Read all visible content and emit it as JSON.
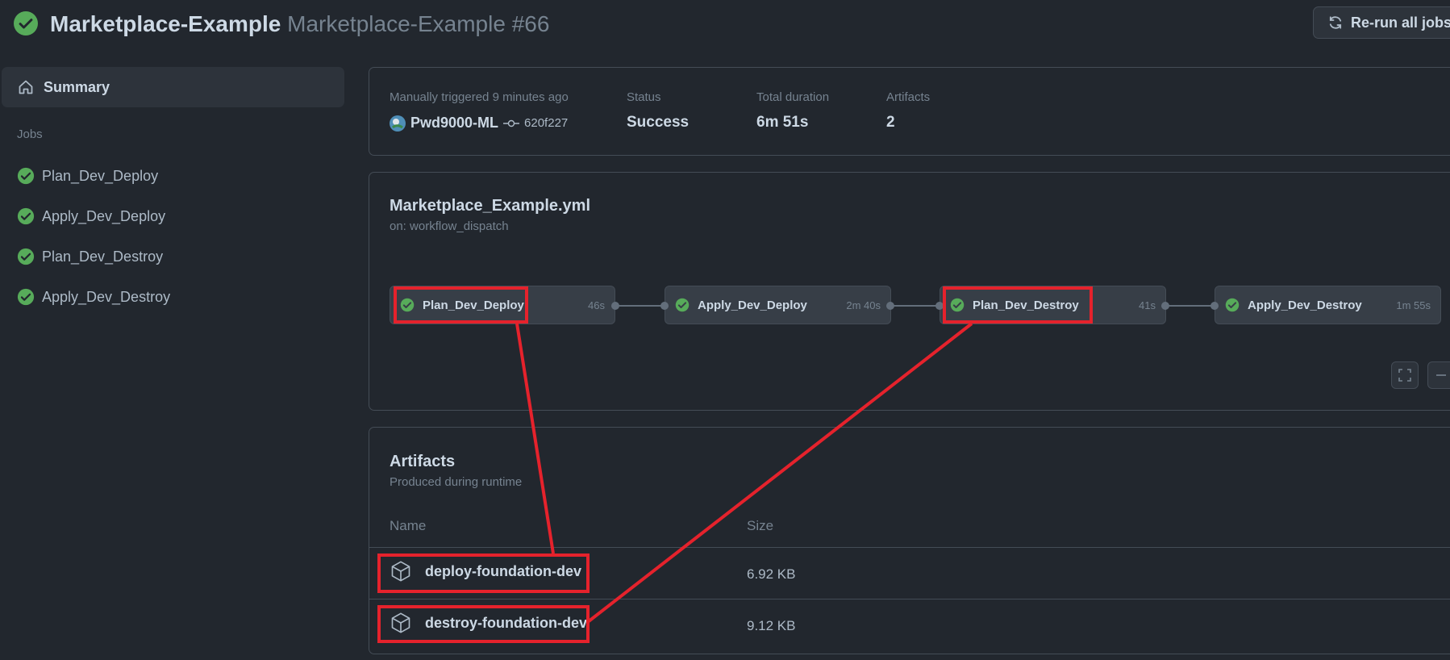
{
  "header": {
    "workflow_name": "Marketplace-Example",
    "run_title": "Marketplace-Example #66",
    "rerun_label": "Re-run all jobs"
  },
  "sidebar": {
    "summary_label": "Summary",
    "jobs_heading": "Jobs",
    "jobs": [
      {
        "label": "Plan_Dev_Deploy",
        "status": "success"
      },
      {
        "label": "Apply_Dev_Deploy",
        "status": "success"
      },
      {
        "label": "Plan_Dev_Destroy",
        "status": "success"
      },
      {
        "label": "Apply_Dev_Destroy",
        "status": "success"
      }
    ]
  },
  "summary": {
    "trigger_label": "Manually triggered 9 minutes ago",
    "actor": "Pwd9000-ML",
    "commit": "620f227",
    "status_label": "Status",
    "status_value": "Success",
    "duration_label": "Total duration",
    "duration_value": "6m 51s",
    "artifacts_label": "Artifacts",
    "artifacts_value": "2"
  },
  "workflow": {
    "file": "Marketplace_Example.yml",
    "trigger": "on: workflow_dispatch",
    "jobs": [
      {
        "name": "Plan_Dev_Deploy",
        "duration": "46s"
      },
      {
        "name": "Apply_Dev_Deploy",
        "duration": "2m 40s"
      },
      {
        "name": "Plan_Dev_Destroy",
        "duration": "41s"
      },
      {
        "name": "Apply_Dev_Destroy",
        "duration": "1m 55s"
      }
    ]
  },
  "artifacts": {
    "title": "Artifacts",
    "subtitle": "Produced during runtime",
    "col_name": "Name",
    "col_size": "Size",
    "rows": [
      {
        "name": "deploy-foundation-dev",
        "size": "6.92 KB"
      },
      {
        "name": "destroy-foundation-dev",
        "size": "9.12 KB"
      }
    ]
  },
  "colors": {
    "success": "#57ab5a",
    "annotation": "#e5222c",
    "background": "#22272e"
  }
}
